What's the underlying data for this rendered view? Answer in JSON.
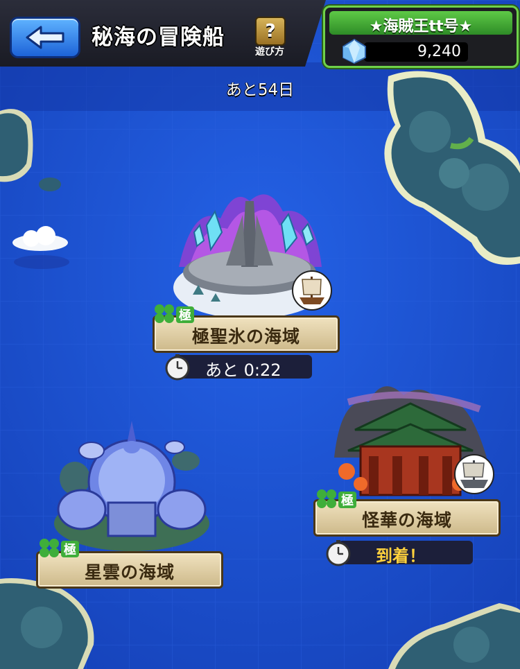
{
  "header": {
    "title": "秘海の冒険船",
    "help_label": "遊び方",
    "help_symbol": "?"
  },
  "player": {
    "name": "★海賊王tt号★",
    "gem_count": "9,240"
  },
  "remaining_days": "あと54日",
  "areas": [
    {
      "name": "極聖氷の海域",
      "badge": "極",
      "timer": "あと 0:22",
      "status": "voyaging"
    },
    {
      "name": "怪華の海域",
      "badge": "極",
      "timer": "到着！",
      "status": "arrived"
    },
    {
      "name": "星雲の海域",
      "badge": "極",
      "status": "idle"
    }
  ],
  "colors": {
    "sea": "#1a4fd0",
    "header": "#1f2029",
    "player_panel_accent": "#6fd24a",
    "arrived_text": "#ffd23d"
  }
}
